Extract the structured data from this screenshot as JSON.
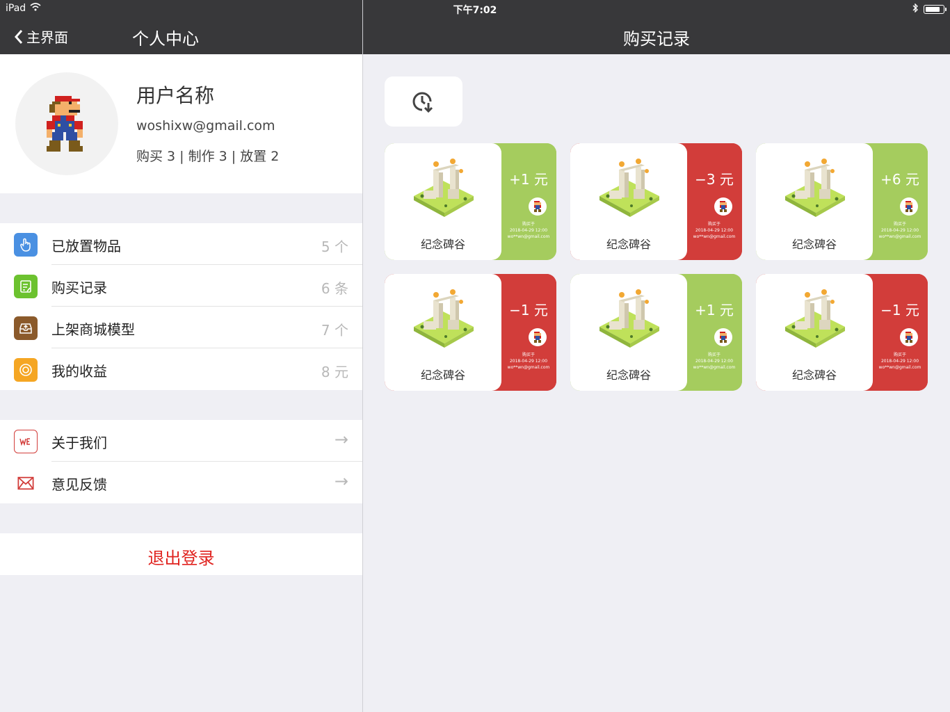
{
  "status_bar": {
    "device": "iPad",
    "time": "下午7:02",
    "battery_level": 0.85
  },
  "left_nav": {
    "back_label": "主界面",
    "title": "个人中心"
  },
  "right_nav": {
    "title": "购买记录"
  },
  "profile": {
    "username": "用户名称",
    "email": "woshixw@gmail.com",
    "stats": "购买 3 | 制作 3 | 放置 2"
  },
  "menu": [
    {
      "label": "已放置物品",
      "value": "5 个",
      "icon": "hand-pointer-icon",
      "color": "#4a90e2"
    },
    {
      "label": "购买记录",
      "value": "6 条",
      "icon": "receipt-icon",
      "color": "#6cc22f"
    },
    {
      "label": "上架商城模型",
      "value": "7 个",
      "icon": "upload-tray-icon",
      "color": "#8b5a2b"
    },
    {
      "label": "我的收益",
      "value": "8 元",
      "icon": "coin-icon",
      "color": "#f5a623"
    }
  ],
  "menu2": [
    {
      "label": "关于我们",
      "value": "→",
      "icon": "we-logo-icon"
    },
    {
      "label": "意见反馈",
      "value": "→",
      "icon": "mail-icon"
    }
  ],
  "logout_label": "退出登录",
  "records": [
    {
      "name": "纪念碑谷",
      "price": "+1 元",
      "status": "green",
      "bought_label": "购买于",
      "date": "2018-04-29 12:00",
      "user": "wo**wn@gmail.com"
    },
    {
      "name": "纪念碑谷",
      "price": "−3 元",
      "status": "red",
      "bought_label": "购买于",
      "date": "2018-04-29 12:00",
      "user": "wo**wn@gmail.com"
    },
    {
      "name": "纪念碑谷",
      "price": "+6 元",
      "status": "green",
      "bought_label": "购买于",
      "date": "2018-04-29 12:00",
      "user": "wo**wn@gmail.com"
    },
    {
      "name": "纪念碑谷",
      "price": "−1 元",
      "status": "red",
      "bought_label": "购买于",
      "date": "2018-04-29 12:00",
      "user": "wo**wn@gmail.com"
    },
    {
      "name": "纪念碑谷",
      "price": "+1 元",
      "status": "green",
      "bought_label": "购买于",
      "date": "2018-04-29 12:00",
      "user": "wo**wn@gmail.com"
    },
    {
      "name": "纪念碑谷",
      "price": "−1 元",
      "status": "red",
      "bought_label": "购买于",
      "date": "2018-04-29 12:00",
      "user": "wo**wn@gmail.com"
    }
  ],
  "colors": {
    "green": "#a5cc5e",
    "red": "#d23d3a",
    "nav": "#38383a",
    "logout": "#e0231f"
  }
}
